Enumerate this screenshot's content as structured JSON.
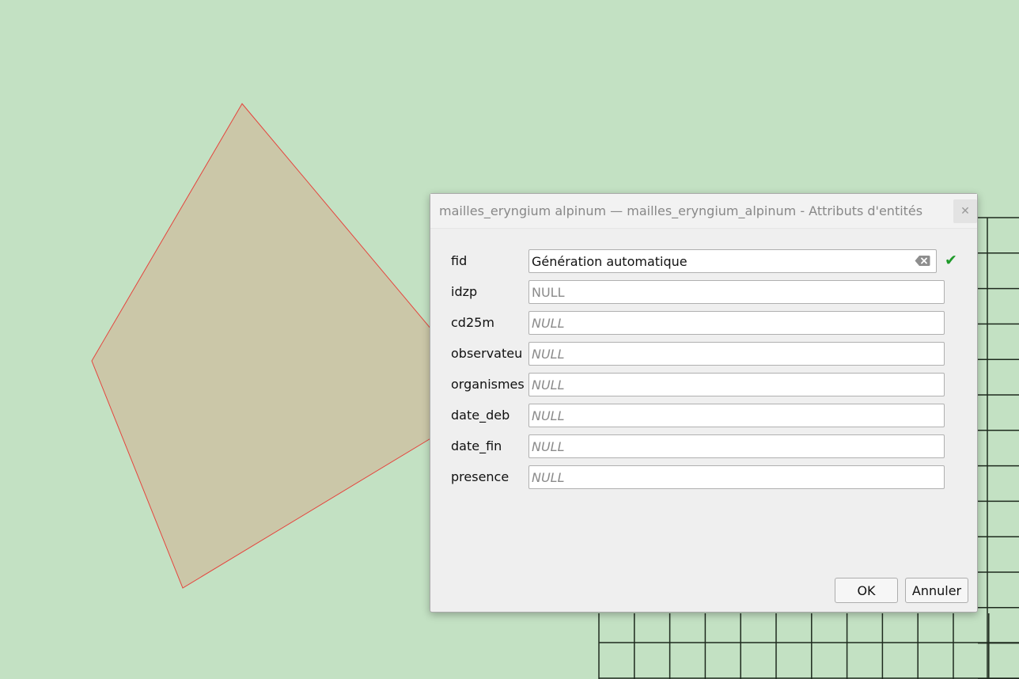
{
  "colors": {
    "map_background": "#c3e1c3",
    "polygon_fill": "#cbc7a8",
    "polygon_stroke": "#e5443d",
    "grid_stroke": "#1e2a1e",
    "check_green": "#1f9a2a"
  },
  "dialog": {
    "title": "mailles_eryngium alpinum — mailles_eryngium_alpinum - Attributs d'entités",
    "close_icon": "close-icon",
    "fields": [
      {
        "label": "fid",
        "value": "Génération automatique",
        "placeholder": ""
      },
      {
        "label": "idzp",
        "value": "",
        "placeholder": "NULL"
      },
      {
        "label": "cd25m",
        "value": "",
        "placeholder": "NULL"
      },
      {
        "label": "observateu",
        "value": "",
        "placeholder": "NULL"
      },
      {
        "label": "organismes",
        "value": "",
        "placeholder": "NULL"
      },
      {
        "label": "date_deb",
        "value": "",
        "placeholder": "NULL"
      },
      {
        "label": "date_fin",
        "value": "",
        "placeholder": "NULL"
      },
      {
        "label": "presence",
        "value": "",
        "placeholder": "NULL"
      }
    ],
    "ok_label": "OK",
    "cancel_label": "Annuler"
  }
}
